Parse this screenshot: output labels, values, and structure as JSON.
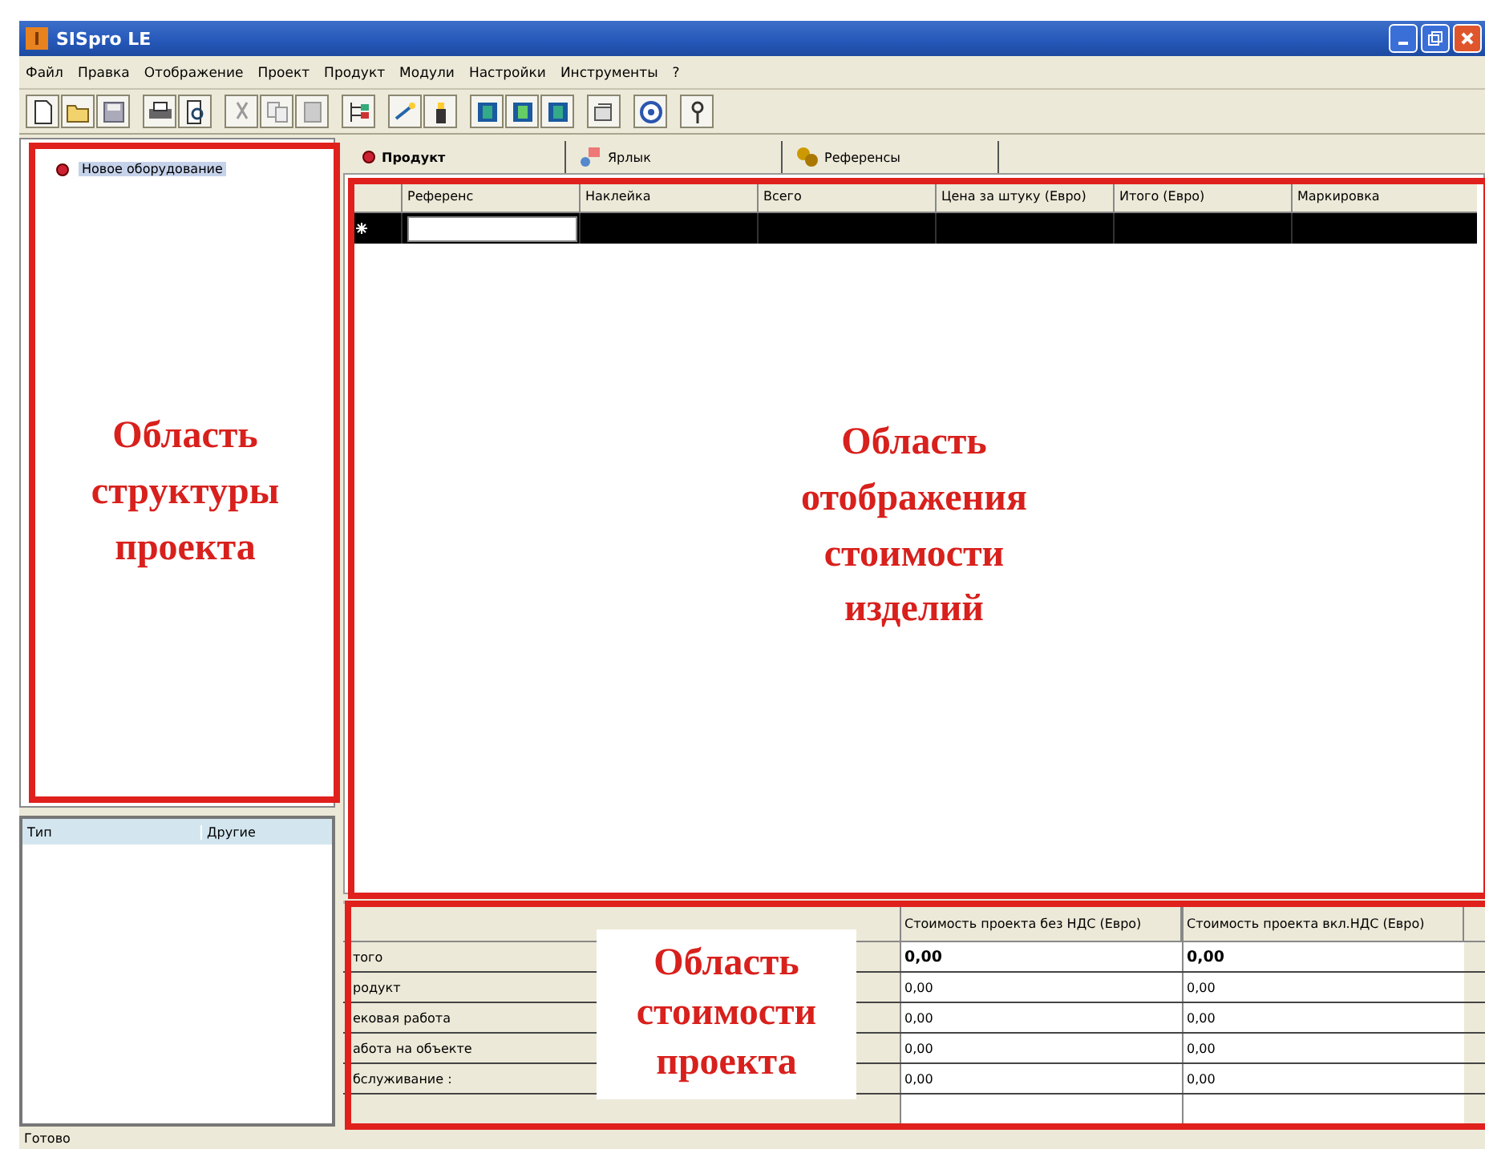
{
  "window": {
    "title": "SISpro LE"
  },
  "menu": [
    "Файл",
    "Правка",
    "Отображение",
    "Проект",
    "Продукт",
    "Модули",
    "Настройки",
    "Инструменты",
    "?"
  ],
  "tree": {
    "items": [
      {
        "label": "Новое оборудование",
        "selected": true
      }
    ]
  },
  "properties": {
    "columns": [
      "Тип",
      "Другие"
    ]
  },
  "tabs": [
    {
      "label": "Продукт",
      "selected": true
    },
    {
      "label": "Ярлык",
      "selected": false
    },
    {
      "label": "Референсы",
      "selected": false
    }
  ],
  "grid": {
    "columns": [
      "Референс",
      "Наклейка",
      "Всего",
      "Цена за штуку (Евро)",
      "Итого (Евро)",
      "Маркировка"
    ]
  },
  "summary": {
    "columns": [
      "Стоимость проекта без НДС (Евро)",
      "Стоимость проекта вкл.НДС (Евро)"
    ],
    "rows": [
      {
        "label": "того",
        "values": [
          "0,00",
          "0,00"
        ],
        "bold": true
      },
      {
        "label": "родукт",
        "values": [
          "0,00",
          "0,00"
        ],
        "bold": false
      },
      {
        "label": "ековая работа",
        "values": [
          "0,00",
          "0,00"
        ],
        "bold": false
      },
      {
        "label": "абота на объекте",
        "values": [
          "0,00",
          "0,00"
        ],
        "bold": false
      },
      {
        "label": "бслуживание :",
        "values": [
          "0,00",
          "0,00"
        ],
        "bold": false
      }
    ]
  },
  "annotations": [
    {
      "kind": "structure",
      "text": "Область\nструктуры\nпроекта"
    },
    {
      "kind": "products",
      "text": "Область\nотображения\nстоимости\nизделий"
    },
    {
      "kind": "project",
      "text": "Область\nстоимости\nпроекта"
    }
  ],
  "status_bar": {
    "text": "Готово"
  }
}
